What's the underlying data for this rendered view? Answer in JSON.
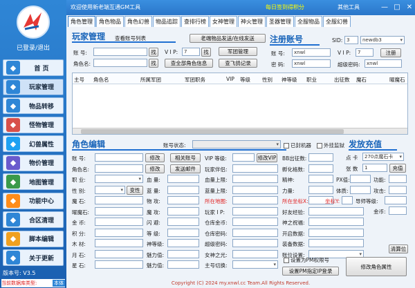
{
  "app": {
    "title": "欢迎使用新老端互通GM工具",
    "checkin": "每日签到得积分",
    "other_tools": "其他工具",
    "min": "—",
    "max": "□",
    "close": "✕"
  },
  "sidebar": {
    "login_status": "已登录/退出",
    "items": [
      {
        "label": "首 页",
        "icon": "home-icon",
        "color": "#2f86d6"
      },
      {
        "label": "玩家管理",
        "icon": "user-icon",
        "color": "#2f86d6"
      },
      {
        "label": "物品转移",
        "icon": "transfer-icon",
        "color": "#2f86d6"
      },
      {
        "label": "怪物管理",
        "icon": "monster-icon",
        "color": "#d8504a"
      },
      {
        "label": "幻兽属性",
        "icon": "pet-icon",
        "color": "#1da1f2"
      },
      {
        "label": "物价管理",
        "icon": "price-icon",
        "color": "#6a5acd"
      },
      {
        "label": "地图管理",
        "icon": "map-icon",
        "color": "#3a9a4a"
      },
      {
        "label": "功能中心",
        "icon": "features-icon",
        "color": "#ff8c1a"
      },
      {
        "label": "合区清理",
        "icon": "merge-icon",
        "color": "#2f86d6"
      },
      {
        "label": "脚本编辑",
        "icon": "script-icon",
        "color": "#f0a020"
      },
      {
        "label": "关于更新",
        "icon": "about-icon",
        "color": "#2f86d6"
      }
    ],
    "version": "版本号: V3.5",
    "db_type_label": "当前数据库类型:",
    "db_type_value": "本体"
  },
  "tabs": [
    "角色管理",
    "角色物品",
    "角色幻兽",
    "物品追踪",
    "查排行榜",
    "女神管理",
    "神火管理",
    "圣器管理",
    "全服物品",
    "全服幻兽"
  ],
  "player_mgmt": {
    "title": "玩家管理",
    "view_list": "查看账号列表",
    "send_items": "老端物品发送/在线发送",
    "account_label": "账 号:",
    "role_label": "角色名:",
    "find": "找",
    "vip_label": "V I P:",
    "vip_value": "7",
    "army_mgmt": "军团管理",
    "all_roles": "查全部角色信息",
    "recharge_log": "查飞鸽记录"
  },
  "register": {
    "title": "注册账号",
    "sid_label": "SID:",
    "sid_value": "3",
    "db_value": "newdb3",
    "account_label": "账 号:",
    "account_value": "xnwl",
    "password_label": "密 码:",
    "password_value": "xnwl",
    "vip_label": "V I P:",
    "vip_value": "7",
    "register_btn": "注册",
    "super_pwd_label": "超级密码:",
    "super_pwd_value": "xnwl"
  },
  "grid": {
    "columns": [
      "主号",
      "角色名",
      "所属军团",
      "军团职务",
      "VIP",
      "等级",
      "性别",
      "神等级",
      "职业",
      "",
      "出征数",
      "魔石",
      "",
      "曜魔石"
    ]
  },
  "role_edit": {
    "title": "角色编辑",
    "account_status": "账号状态:",
    "banned_label": "已封机器",
    "external_ban": "外挂监狱",
    "fields_col1": [
      "账 号:",
      "角色名:",
      "职 业:",
      "性 别:",
      "魔 石:",
      "曜魔石:",
      "金 币:",
      "积 分:",
      "木 材:",
      "月 石:",
      "星 石:"
    ],
    "gender_btn": "变性",
    "edit": "修改",
    "related_accounts": "相关账号",
    "send_mail": "发送邮件",
    "fields_col2": [
      "血 量:",
      "蓝 量:",
      "物 攻:",
      "魔 攻:",
      "闪 避:",
      "等 级:",
      "神等级:",
      "魅力值:",
      "魅力值:"
    ],
    "vip_level": "VIP 等级:",
    "modify_vip": "修改VIP",
    "companion": "玩家伴侣:",
    "fields_col3": [
      "血量上限:",
      "蓝量上限:",
      "所在地图:",
      "玩家 I P:",
      "仓库金币:",
      "仓库密码:",
      "超级密码:",
      "女神之光:",
      "主号切换:"
    ],
    "fields_col4": [
      "BB出征数:",
      "孵化格数:",
      "精神:",
      "力量:",
      "所在坐标X:",
      "好友经验:",
      "神之祝福:",
      "开启数据:",
      "装备数据:",
      "账位设置:"
    ],
    "px_label": "PX值:",
    "function_label": "功能:",
    "stamina_label": "体质:",
    "attack_label": "攻击:",
    "coord_y": "坐标Y:",
    "mentor_level": "导师等级:",
    "pm_check": "设置为PM权限号",
    "pm_ip": "设置PM指定IP登录",
    "modify_role": "修改角色属性",
    "clear_pos": "清算位",
    "gold_label": "金币:"
  },
  "recharge": {
    "title": "发放充值",
    "card_label": "点 卡",
    "card_value": "270点魔石卡",
    "count_label": "张 数",
    "count_value": "1",
    "recharge_btn": "充值"
  },
  "footer": "Copyright (C) 2024 my.xnwl.cc Team.All Rights Reserved."
}
